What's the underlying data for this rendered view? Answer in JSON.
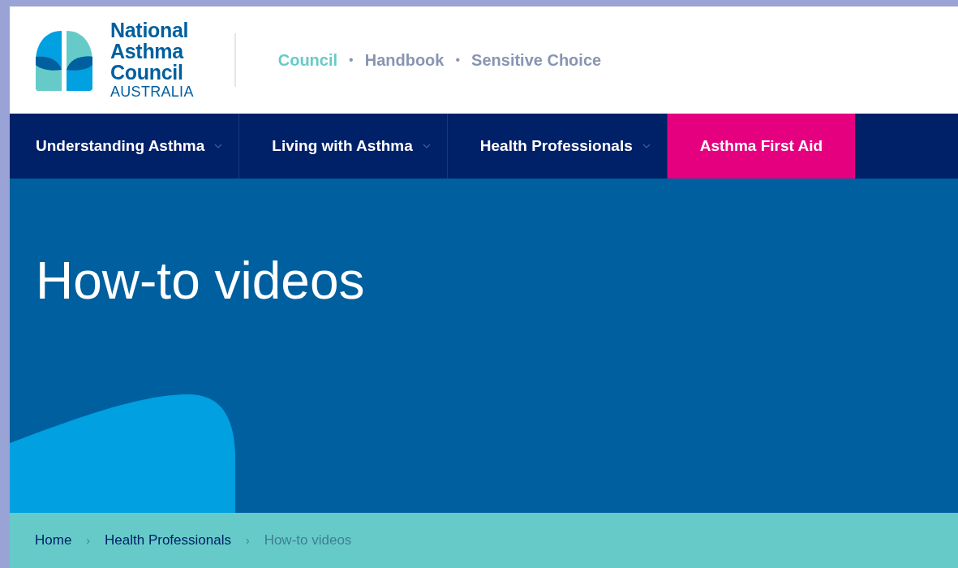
{
  "logo": {
    "lines": [
      "National",
      "Asthma",
      "Council"
    ],
    "country": "AUSTRALIA"
  },
  "top_links": {
    "separator": "•",
    "items": [
      {
        "label": "Council",
        "selected": true
      },
      {
        "label": "Handbook",
        "selected": false
      },
      {
        "label": "Sensitive Choice",
        "selected": false
      }
    ]
  },
  "nav": [
    {
      "label": "Understanding Asthma",
      "dropdown": true,
      "highlighted": false
    },
    {
      "label": "Living with Asthma",
      "dropdown": true,
      "highlighted": false
    },
    {
      "label": "Health Professionals",
      "dropdown": true,
      "highlighted": false
    },
    {
      "label": "Asthma First Aid",
      "dropdown": false,
      "highlighted": true
    }
  ],
  "hero": {
    "title": "How-to videos"
  },
  "breadcrumb": {
    "separator": "›",
    "items": [
      {
        "label": "Home",
        "current": false
      },
      {
        "label": "Health Professionals",
        "current": false
      },
      {
        "label": "How-to videos",
        "current": true
      }
    ]
  }
}
